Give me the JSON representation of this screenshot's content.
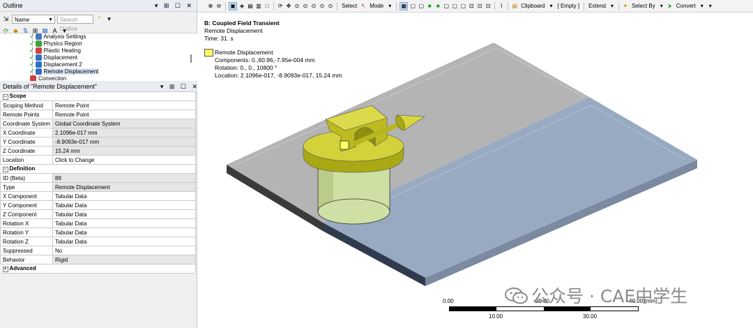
{
  "outline": {
    "title": "Outline",
    "filter_value": "Name",
    "search_placeholder": "Search Outline",
    "sort_label": "A",
    "tree_items": [
      {
        "label": "Analysis Settings",
        "icon": "analysis-settings-icon",
        "color": "#4a72c0"
      },
      {
        "label": "Physics Region",
        "icon": "physics-region-icon",
        "color": "#3aa33a"
      },
      {
        "label": "Plastic Heating",
        "icon": "plastic-heating-icon",
        "color": "#d04040"
      },
      {
        "label": "Displacement",
        "icon": "displacement-icon",
        "color": "#3070c0"
      },
      {
        "label": "Displacement 2",
        "icon": "displacement-icon",
        "color": "#3070c0"
      },
      {
        "label": "Remote Displacement",
        "icon": "remote-displacement-icon",
        "color": "#3070c0",
        "selected": true
      },
      {
        "label": "Convection",
        "icon": "convection-icon",
        "color": "#d04040"
      }
    ]
  },
  "details": {
    "title": "Details of \"Remote Displacement\"",
    "sections": [
      {
        "name": "Scope",
        "rows": [
          {
            "key": "Scoping Method",
            "value": "Remote Point"
          },
          {
            "key": "Remote Points",
            "value": "Remote Point"
          },
          {
            "key": "Coordinate System",
            "value": "Global Coordinate System",
            "gray": true
          },
          {
            "key": "X Coordinate",
            "value": "2.1096e-017 mm",
            "gray": true
          },
          {
            "key": "Y Coordinate",
            "value": "-8.9093e-017 mm",
            "gray": true
          },
          {
            "key": "Z Coordinate",
            "value": "15.24 mm",
            "gray": true
          },
          {
            "key": "Location",
            "value": "Click to Change"
          }
        ]
      },
      {
        "name": "Definition",
        "rows": [
          {
            "key": "ID (Beta)",
            "value": "89",
            "gray": true
          },
          {
            "key": "Type",
            "value": "Remote Displacement",
            "gray": true
          },
          {
            "key": "X Component",
            "value": "Tabular Data"
          },
          {
            "key": "Y Component",
            "value": "Tabular Data"
          },
          {
            "key": "Z Component",
            "value": "Tabular Data"
          },
          {
            "key": " Rotation X",
            "value": "Tabular Data"
          },
          {
            "key": " Rotation Y",
            "value": "Tabular Data"
          },
          {
            "key": " Rotation Z",
            "value": "Tabular Data"
          },
          {
            "key": "Suppressed",
            "value": "No"
          },
          {
            "key": "Behavior",
            "value": "Rigid",
            "gray": true
          }
        ]
      },
      {
        "name": "Advanced",
        "rows": [],
        "collapsed": true
      }
    ]
  },
  "toolbar": {
    "select_label": "Select",
    "mode_label": "Mode",
    "clipboard_label": "Clipboard",
    "empty_label": "[ Empty ]",
    "extend_label": "Extend",
    "select_by_label": "Select By",
    "convert_label": "Convert"
  },
  "viewport": {
    "analysis_title": "B: Coupled Field Transient",
    "object_name": "Remote Displacement",
    "time": "Time: 31. s",
    "legend_label": "Remote Displacement",
    "components": "Components: 0.,60.96,-7.95e-004 mm",
    "rotation": "Rotation: 0., 0., 10800 °",
    "location": "Location: 2.1096e-017, -8.9093e-017, 15.24 mm",
    "scale_top": [
      "0.00",
      "20.00",
      "40.00 (mm)"
    ],
    "scale_bottom": [
      "10.00",
      "30.00"
    ],
    "legend_color": "#ffff66"
  },
  "watermark": "公众号 · CAE中学生"
}
